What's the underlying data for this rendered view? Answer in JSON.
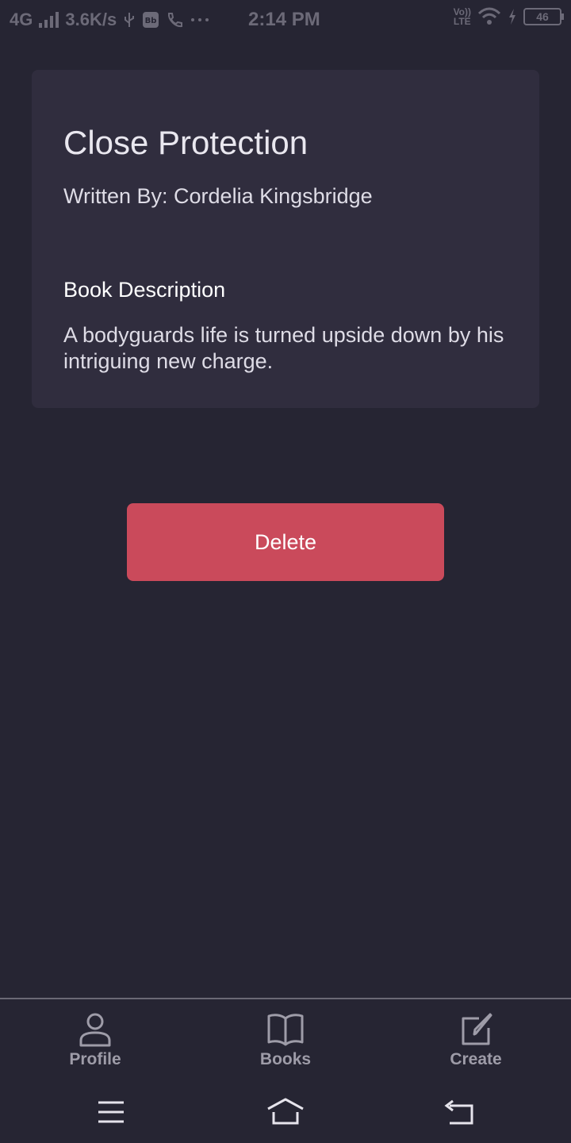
{
  "status_bar": {
    "network": "4G",
    "speed": "3.6K/s",
    "time": "2:14 PM",
    "volte_top": "Vo))",
    "volte_bottom": "LTE",
    "battery": "46"
  },
  "book": {
    "title": "Close Protection",
    "author_line": "Written By: Cordelia Kingsbridge",
    "description_heading": "Book Description",
    "description": "A bodyguards life is turned upside down by his intriguing new charge."
  },
  "actions": {
    "delete_label": "Delete",
    "delete_color": "#ca4a5b"
  },
  "bottom_nav": {
    "items": [
      {
        "label": "Profile",
        "icon": "person-icon"
      },
      {
        "label": "Books",
        "icon": "open-book-icon"
      },
      {
        "label": "Create",
        "icon": "edit-icon"
      }
    ]
  },
  "system_nav": {
    "buttons": [
      "menu-icon",
      "home-icon",
      "back-icon"
    ]
  },
  "colors": {
    "background": "#262533",
    "card": "#302d3e",
    "nav_text": "#9e9ca8"
  }
}
